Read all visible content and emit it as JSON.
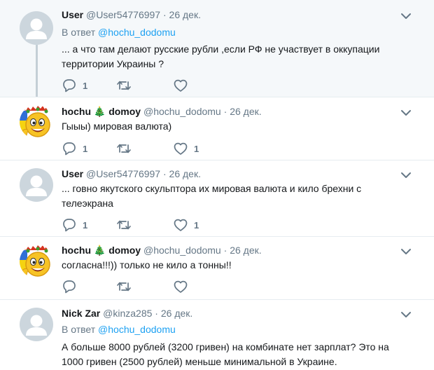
{
  "tweets": [
    {
      "name": "User",
      "handle": "@User54776997",
      "dot": "·",
      "date": "26 дек.",
      "reply_prefix": "В ответ",
      "reply_to": "@hochu_dodomu",
      "text": "... а что там делают русские рубли ,если РФ не участвует в оккупации территории Украины ?",
      "replies": "1",
      "retweets": "",
      "likes": ""
    },
    {
      "name": "hochu 🎄 domoy",
      "handle": "@hochu_dodomu",
      "dot": "·",
      "date": "26 дек.",
      "text": "Гыыы)  мировая  валюта)",
      "replies": "1",
      "retweets": "",
      "likes": "1"
    },
    {
      "name": "User",
      "handle": "@User54776997",
      "dot": "·",
      "date": "26 дек.",
      "text": "... говно якутского скульптора их мировая валюта и кило брехни с телеэкрана",
      "replies": "1",
      "retweets": "",
      "likes": "1"
    },
    {
      "name": "hochu 🎄 domoy",
      "handle": "@hochu_dodomu",
      "dot": "·",
      "date": "26 дек.",
      "text": "согласна!!!)) только не  кило  а  тонны!!",
      "replies": "",
      "retweets": "",
      "likes": ""
    },
    {
      "name": "Nick Zar",
      "handle": "@kinza285",
      "dot": "·",
      "date": "26 дек.",
      "reply_prefix": "В ответ",
      "reply_to": "@hochu_dodomu",
      "text": "А больше 8000 рублей (3200 гривен) на комбинате нет зарплат? Это на 1000 гривен (2500 рублей) меньше минимальной в Украине.",
      "replies": "",
      "retweets": "",
      "likes": ""
    }
  ],
  "colors": {
    "highlight_bg": "#f5f8fa",
    "icon_gray": "#657786",
    "link_blue": "#1da1f2",
    "separator": "#e6ecf0",
    "thread_line": "#c4cfd6"
  }
}
